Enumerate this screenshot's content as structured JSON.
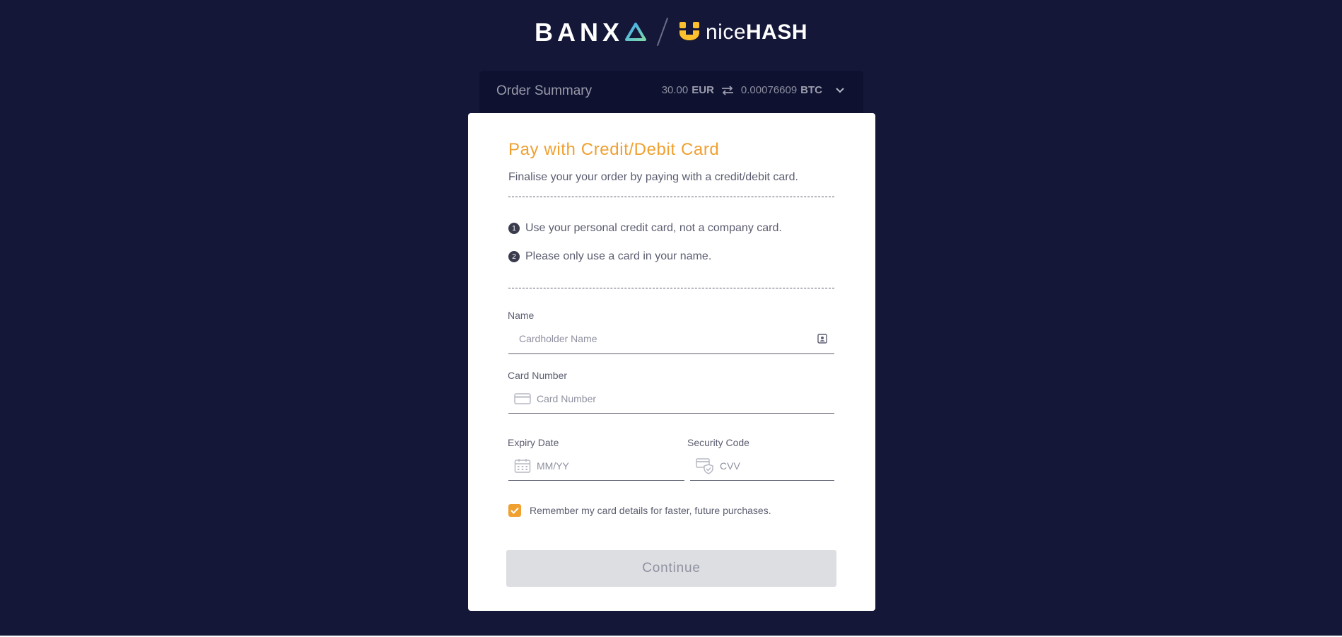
{
  "brand": {
    "banxa": "BANX",
    "nicehash_light": "nice",
    "nicehash_bold": "HASH",
    "accent_color": "#f0a030"
  },
  "order_summary": {
    "title": "Order Summary",
    "fiat_amount": "30.00",
    "fiat_currency": "EUR",
    "crypto_amount": "0.00076609",
    "crypto_currency": "BTC"
  },
  "payment": {
    "title": "Pay with Credit/Debit Card",
    "subtitle": "Finalise your your order by paying with a credit/debit card.",
    "rules": [
      {
        "num": "1",
        "text": "Use your personal credit card, not a company card."
      },
      {
        "num": "2",
        "text": "Please only use a card in your name."
      }
    ],
    "name": {
      "label": "Name",
      "placeholder": "Cardholder Name",
      "value": ""
    },
    "card_number": {
      "label": "Card Number",
      "placeholder": "Card Number",
      "value": ""
    },
    "expiry": {
      "label": "Expiry Date",
      "placeholder": "MM/YY",
      "value": ""
    },
    "security": {
      "label": "Security Code",
      "placeholder": "CVV",
      "value": ""
    },
    "remember": {
      "label": "Remember my card details for faster, future purchases.",
      "checked": true
    },
    "continue_label": "Continue"
  },
  "icons": {
    "swap": "swap-arrows-icon",
    "chevron": "chevron-down-icon",
    "contact": "contact-card-icon",
    "card": "credit-card-icon",
    "calendar": "calendar-icon",
    "cvv": "card-shield-icon",
    "check": "checkmark-icon"
  }
}
